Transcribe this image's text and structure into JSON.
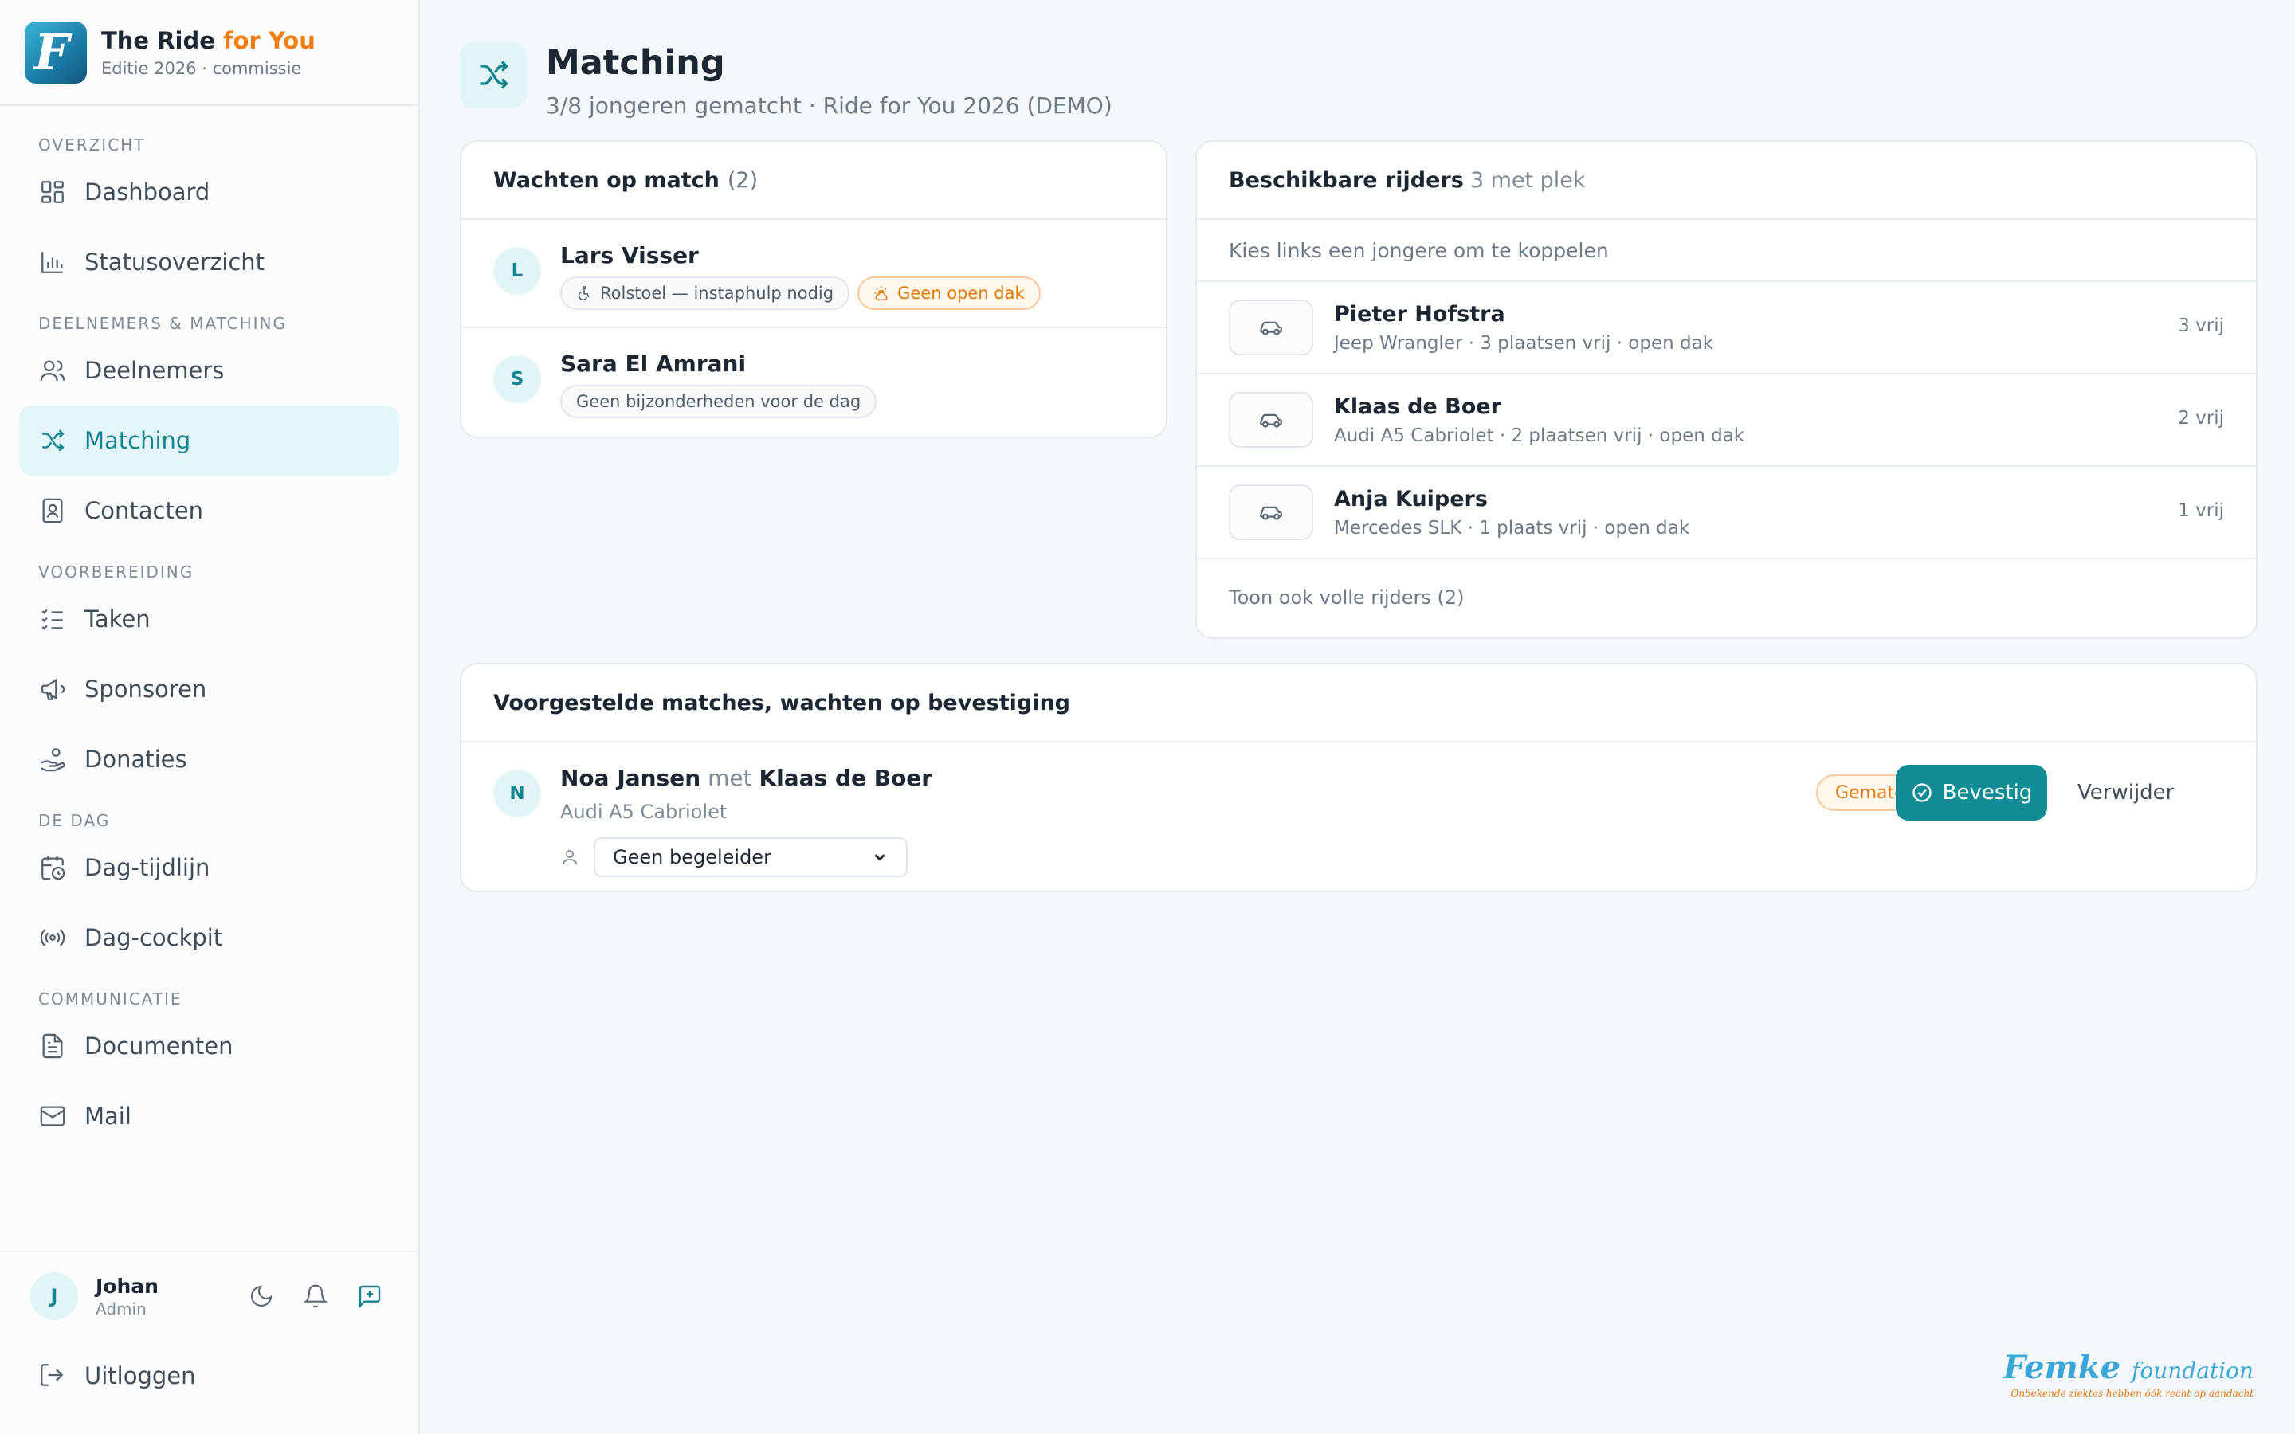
{
  "brand": {
    "title_main": "The Ride ",
    "title_accent": "for You",
    "subtitle": "Editie 2026 · commissie",
    "accent_color": "#f07d0d"
  },
  "sidebar": {
    "sections": [
      {
        "label": "OVERZICHT",
        "items": [
          {
            "label": "Dashboard",
            "icon": "dashboard-icon"
          },
          {
            "label": "Statusoverzicht",
            "icon": "bar-chart-icon"
          }
        ]
      },
      {
        "label": "DEELNEMERS & MATCHING",
        "items": [
          {
            "label": "Deelnemers",
            "icon": "users-icon"
          },
          {
            "label": "Matching",
            "icon": "shuffle-icon",
            "active": true
          },
          {
            "label": "Contacten",
            "icon": "contact-book-icon"
          }
        ]
      },
      {
        "label": "VOORBEREIDING",
        "items": [
          {
            "label": "Taken",
            "icon": "checklist-icon"
          },
          {
            "label": "Sponsoren",
            "icon": "megaphone-icon"
          },
          {
            "label": "Donaties",
            "icon": "hand-coins-icon"
          }
        ]
      },
      {
        "label": "DE DAG",
        "items": [
          {
            "label": "Dag-tijdlijn",
            "icon": "calendar-clock-icon"
          },
          {
            "label": "Dag-cockpit",
            "icon": "radio-icon"
          }
        ]
      },
      {
        "label": "COMMUNICATIE",
        "items": [
          {
            "label": "Documenten",
            "icon": "document-icon"
          },
          {
            "label": "Mail",
            "icon": "mail-icon"
          }
        ]
      }
    ],
    "user": {
      "initial": "J",
      "name": "Johan",
      "role": "Admin"
    },
    "user_actions": [
      "moon-icon",
      "bell-icon",
      "message-plus-icon"
    ],
    "logout_label": "Uitloggen"
  },
  "page": {
    "icon": "shuffle-icon",
    "title": "Matching",
    "subtitle": "3/8 jongeren gematcht · Ride for You 2026 (DEMO)"
  },
  "waiting": {
    "title": "Wachten op match",
    "count": "(2)",
    "people": [
      {
        "initial": "L",
        "name": "Lars Visser",
        "tags": [
          {
            "label": "Rolstoel — instaphulp nodig",
            "style": "neutral",
            "icon": "wheelchair-icon"
          },
          {
            "label": "Geen open dak",
            "style": "orange",
            "icon": "sun-cloud-icon"
          }
        ]
      },
      {
        "initial": "S",
        "name": "Sara El Amrani",
        "tags": [
          {
            "label": "Geen bijzonderheden voor de dag",
            "style": "neutral",
            "icon": ""
          }
        ]
      }
    ]
  },
  "riders": {
    "title": "Beschikbare rijders",
    "count": "3 met plek",
    "hint": "Kies links een jongere om te koppelen",
    "list": [
      {
        "name": "Pieter Hofstra",
        "car": "Jeep Wrangler · 3 plaatsen vrij · open dak",
        "free": "3 vrij"
      },
      {
        "name": "Klaas de Boer",
        "car": "Audi A5 Cabriolet · 2 plaatsen vrij · open dak",
        "free": "2 vrij"
      },
      {
        "name": "Anja Kuipers",
        "car": "Mercedes SLK · 1 plaats vrij · open dak",
        "free": "1 vrij"
      }
    ],
    "footer": "Toon ook volle rijders (2)"
  },
  "proposed": {
    "title": "Voorgestelde matches, wachten op bevestiging",
    "matches": [
      {
        "initial": "N",
        "young": "Noa Jansen",
        "met": "met",
        "rider": "Klaas de Boer",
        "car": "Audi A5 Cabriolet",
        "escort_value": "Geen begeleider",
        "status": "Gematcht",
        "confirm_label": "Bevestig",
        "remove_label": "Verwijder"
      }
    ]
  },
  "footer_logo": {
    "main": "Femke",
    "small": "foundation",
    "tagline": "Onbekende ziektes hebben óók recht op aandacht"
  },
  "colors": {
    "teal": "#118c96",
    "orange": "#e27709",
    "active_bg": "#e3f5f8"
  }
}
